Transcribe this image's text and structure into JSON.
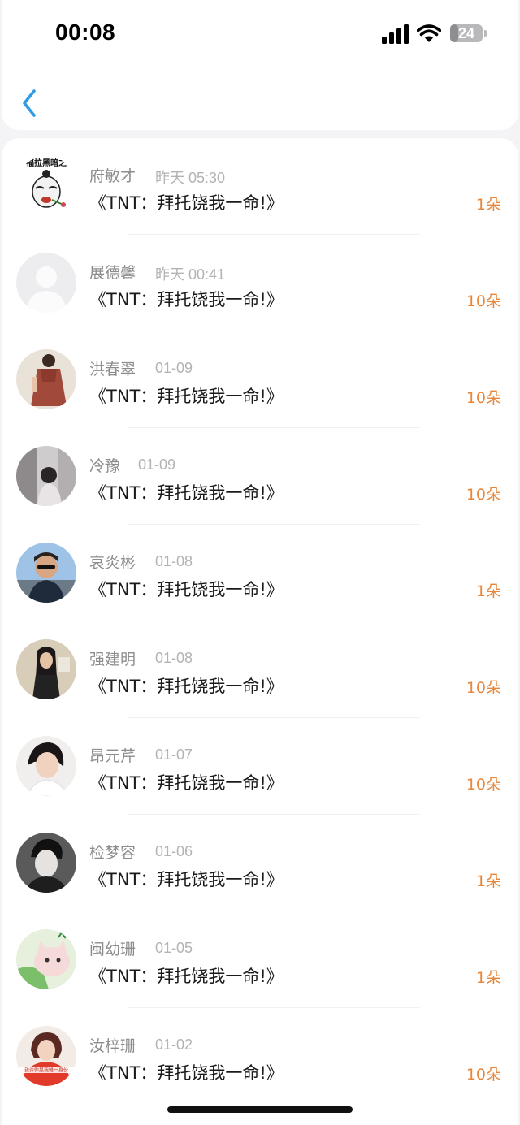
{
  "status_bar": {
    "time": "00:08",
    "battery": "24",
    "battery_level": 0.24
  },
  "nav": {
    "back_icon": "chevron-left-icon",
    "back_color": "#2f9be6"
  },
  "colors": {
    "count": "#e8873b",
    "name": "#8c8c8c",
    "time": "#b3b3b3"
  },
  "rows": [
    {
      "name": "府敏才",
      "time": "昨天 05:30",
      "title": "《TNT：拜托饶我一命!》",
      "count": "1朵",
      "avatar": "cartoon-avatar",
      "avatar_caption": "福拉黑暗之"
    },
    {
      "name": "展德馨",
      "time": "昨天 00:41",
      "title": "《TNT：拜托饶我一命!》",
      "count": "10朵",
      "avatar": "default-avatar"
    },
    {
      "name": "洪春翠",
      "time": "01-09",
      "title": "《TNT：拜托饶我一命!》",
      "count": "10朵",
      "avatar": "photo-avatar"
    },
    {
      "name": "冷豫",
      "time": "01-09",
      "title": "《TNT：拜托饶我一命!》",
      "count": "10朵",
      "avatar": "photo-avatar"
    },
    {
      "name": "哀炎彬",
      "time": "01-08",
      "title": "《TNT：拜托饶我一命!》",
      "count": "1朵",
      "avatar": "photo-avatar"
    },
    {
      "name": "强建明",
      "time": "01-08",
      "title": "《TNT：拜托饶我一命!》",
      "count": "10朵",
      "avatar": "photo-avatar"
    },
    {
      "name": "昂元芹",
      "time": "01-07",
      "title": "《TNT：拜托饶我一命!》",
      "count": "10朵",
      "avatar": "photo-avatar"
    },
    {
      "name": "检梦容",
      "time": "01-06",
      "title": "《TNT：拜托饶我一命!》",
      "count": "1朵",
      "avatar": "photo-avatar"
    },
    {
      "name": "闽幼珊",
      "time": "01-05",
      "title": "《TNT：拜托饶我一命!》",
      "count": "1朵",
      "avatar": "cat-avatar"
    },
    {
      "name": "汝梓珊",
      "time": "01-02",
      "title": "《TNT：拜托饶我一命!》",
      "count": "10朵",
      "avatar": "photo-avatar",
      "avatar_caption": "我许你是我唯一身份"
    }
  ]
}
